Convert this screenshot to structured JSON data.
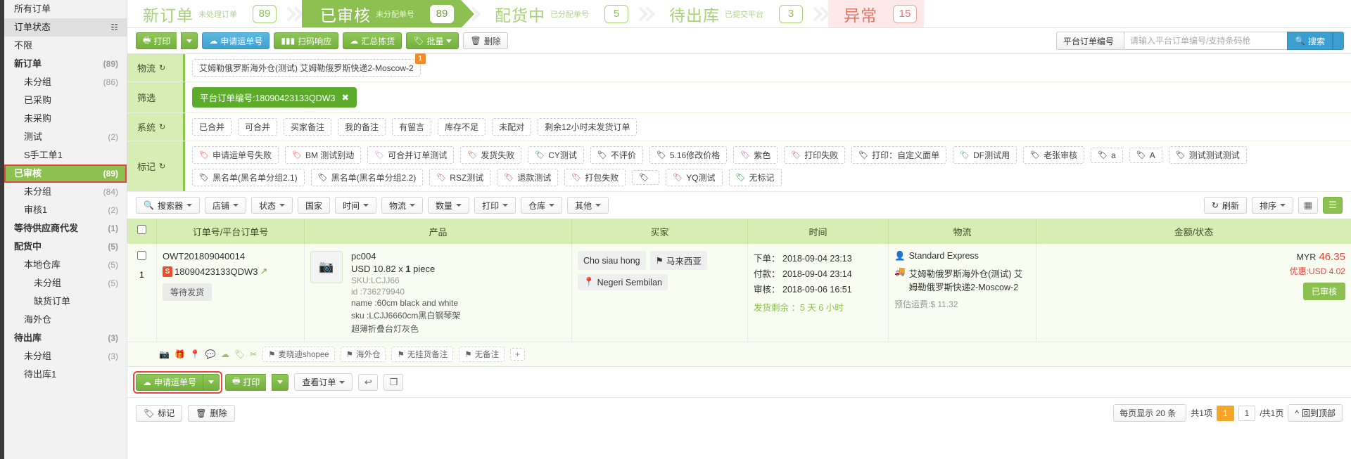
{
  "sidebar": {
    "items": [
      {
        "label": "所有订单",
        "count": "",
        "level": 0,
        "style": "plain"
      },
      {
        "label": "订单状态",
        "count": "",
        "level": 0,
        "style": "head",
        "icon": "sitemap-icon"
      },
      {
        "label": "不限",
        "count": "",
        "level": 0,
        "style": "plain"
      },
      {
        "label": "新订单",
        "count": "(89)",
        "level": 0,
        "style": "bold"
      },
      {
        "label": "未分组",
        "count": "(86)",
        "level": 1,
        "style": "plain"
      },
      {
        "label": "已采购",
        "count": "",
        "level": 1,
        "style": "plain"
      },
      {
        "label": "未采购",
        "count": "",
        "level": 1,
        "style": "plain"
      },
      {
        "label": "测试",
        "count": "(2)",
        "level": 1,
        "style": "plain"
      },
      {
        "label": "S手工单1",
        "count": "",
        "level": 1,
        "style": "plain"
      },
      {
        "label": "已审核",
        "count": "(89)",
        "level": 0,
        "style": "active"
      },
      {
        "label": "未分组",
        "count": "(84)",
        "level": 1,
        "style": "plain"
      },
      {
        "label": "审核1",
        "count": "(2)",
        "level": 1,
        "style": "plain"
      },
      {
        "label": "等待供应商代发",
        "count": "(1)",
        "level": 0,
        "style": "bold"
      },
      {
        "label": "配货中",
        "count": "(5)",
        "level": 0,
        "style": "bold"
      },
      {
        "label": "本地仓库",
        "count": "(5)",
        "level": 1,
        "style": "plain"
      },
      {
        "label": "未分组",
        "count": "(5)",
        "level": 2,
        "style": "plain"
      },
      {
        "label": "缺货订单",
        "count": "",
        "level": 2,
        "style": "plain"
      },
      {
        "label": "海外仓",
        "count": "",
        "level": 1,
        "style": "plain"
      },
      {
        "label": "待出库",
        "count": "(3)",
        "level": 0,
        "style": "bold"
      },
      {
        "label": "未分组",
        "count": "(3)",
        "level": 1,
        "style": "plain"
      },
      {
        "label": "待出库1",
        "count": "",
        "level": 1,
        "style": "plain"
      }
    ]
  },
  "steps": [
    {
      "name": "新订单",
      "sub": "未处理订单",
      "badge": "89",
      "state": "normal"
    },
    {
      "name": "已审核",
      "sub": "未分配单号",
      "badge": "89",
      "state": "current"
    },
    {
      "name": "配货中",
      "sub": "已分配单号",
      "badge": "5",
      "state": "normal"
    },
    {
      "name": "待出库",
      "sub": "已提交平台",
      "badge": "3",
      "state": "normal"
    },
    {
      "name": "异常",
      "sub": "",
      "badge": "15",
      "state": "error"
    }
  ],
  "toolbar": {
    "print": "打印",
    "apply_waybill": "申请运单号",
    "scan_response": "扫码响应",
    "batch_pick": "汇总拣货",
    "batch": "批量",
    "delete": "删除",
    "search_field_label": "平台订单编号",
    "search_placeholder": "请输入平台订单编号/支持条码枪",
    "search_button": "搜索"
  },
  "filters": {
    "rows": [
      {
        "label": "物流",
        "refresh": true,
        "type": "chips",
        "chips": [
          {
            "text": "艾姆勒俄罗斯海外仓(测试) 艾姆勒俄罗斯快递2-Moscow-2",
            "selected": false,
            "badge": "1"
          }
        ]
      },
      {
        "label": "筛选",
        "refresh": false,
        "type": "chips",
        "chips": [
          {
            "text": "平台订单编号:18090423133QDW3",
            "selected": true,
            "closable": true
          }
        ]
      },
      {
        "label": "系统",
        "refresh": true,
        "type": "chips",
        "chips": [
          {
            "text": "已合并"
          },
          {
            "text": "可合并"
          },
          {
            "text": "买家备注"
          },
          {
            "text": "我的备注"
          },
          {
            "text": "有留言"
          },
          {
            "text": "库存不足"
          },
          {
            "text": "未配对"
          },
          {
            "text": "剩余12小时未发货订单"
          }
        ]
      },
      {
        "label": "标记",
        "refresh": true,
        "type": "tags",
        "chips": [
          {
            "text": "申请运单号失败",
            "color": "#e8453c"
          },
          {
            "text": "BM 测试别动",
            "color": "#e8573c"
          },
          {
            "text": "可合并订单测试",
            "color": "#ea7fe0"
          },
          {
            "text": "发货失败",
            "color": "#e8453c"
          },
          {
            "text": "CY测试",
            "color": "#1a8a3a"
          },
          {
            "text": "不评价",
            "color": "#111111"
          },
          {
            "text": "5.16修改价格",
            "color": "#111111"
          },
          {
            "text": "紫色",
            "color": "#ec2fd0"
          },
          {
            "text": "打印失败",
            "color": "#e8453c"
          },
          {
            "text": "打印：自定义面单",
            "color": "#111111"
          },
          {
            "text": "DF测试用",
            "color": "#2a9d9d"
          },
          {
            "text": "老张审核",
            "color": "#111111"
          },
          {
            "text": "a",
            "color": "#111111"
          },
          {
            "text": "A",
            "color": "#111111"
          },
          {
            "text": "测试测试测试",
            "color": "#111111"
          },
          {
            "text": "黑名单(黑名单分组2.1)",
            "color": "#111111"
          },
          {
            "text": "黑名单(黑名单分组2.2)",
            "color": "#111111"
          },
          {
            "text": "RSZ测试",
            "color": "#e8453c"
          },
          {
            "text": "退款测试",
            "color": "#e8453c"
          },
          {
            "text": "打包失败",
            "color": "#e8453c"
          },
          {
            "text": "",
            "color": "#111111"
          },
          {
            "text": "YQ测试",
            "color": "#e8453c"
          },
          {
            "text": "无标记",
            "color": "#1a8a3a"
          }
        ]
      }
    ]
  },
  "subbar": {
    "buttons": [
      {
        "label": "搜索器",
        "icon": "search-icon",
        "caret": true
      },
      {
        "label": "店铺",
        "caret": true
      },
      {
        "label": "状态",
        "caret": true
      },
      {
        "label": "国家",
        "caret": false
      },
      {
        "label": "时间",
        "caret": true
      },
      {
        "label": "物流",
        "caret": true
      },
      {
        "label": "数量",
        "caret": true
      },
      {
        "label": "打印",
        "caret": true
      },
      {
        "label": "仓库",
        "caret": true
      },
      {
        "label": "其他",
        "caret": true
      }
    ],
    "refresh": "刷新",
    "sort": "排序",
    "view_grid": "grid-view-icon",
    "view_list": "list-view-icon"
  },
  "table": {
    "headers": [
      "",
      "订单号/平台订单号",
      "产品",
      "买家",
      "时间",
      "物流",
      "金额/状态"
    ],
    "rows": [
      {
        "index": "1",
        "order_no": "OWT201809040014",
        "platform_no": "18090423133QDW3",
        "platform_icon": "shopee-icon",
        "status_pill": "等待发货",
        "product": {
          "name": "pc004",
          "price": "USD 10.82 x ",
          "qty": "1",
          "unit": " piece",
          "sku": "SKU:LCJJ66",
          "id": "id :736279940",
          "name_line": "name :60cm black and white",
          "sku_line": "sku :LCJJ6660cm黑白钢琴架",
          "title_cn": "超薄折叠台灯灰色"
        },
        "buyer": {
          "name": "Cho siau hong",
          "country": "马来西亚",
          "region": "Negeri Sembilan"
        },
        "time": {
          "order_label": "下单：",
          "order_value": "2018-09-04 23:13",
          "pay_label": "付款：",
          "pay_value": "2018-09-04 23:14",
          "audit_label": "审核：",
          "audit_value": "2018-09-06 16:51",
          "remain": "发货剩余 ：5 天 6 小时"
        },
        "logistics": {
          "carrier": "Standard Express",
          "channel": "艾姆勒俄罗斯海外仓(测试) 艾姆勒俄罗斯快递2-Moscow-2",
          "fee": "预估运费:$ 11.32"
        },
        "amount": {
          "currency": "MYR",
          "value": "46.35",
          "discount": "优惠:USD 4.02",
          "status": "已审核"
        },
        "row_tags": [
          {
            "label": "麦晓迪shopee",
            "icon": "link-icon"
          },
          {
            "label": "海外仓",
            "icon": "plane-icon"
          },
          {
            "label": "无挂货备注",
            "icon": "note-icon"
          },
          {
            "label": "无备注",
            "icon": "note-icon"
          }
        ]
      }
    ]
  },
  "row_actions": {
    "apply_waybill": "申请运单号",
    "print": "打印",
    "view_order": "查看订单",
    "undo_icon": "undo-icon",
    "copy_icon": "copy-icon"
  },
  "bottom": {
    "mark": "标记",
    "delete": "删除",
    "per_page": "每页显示 20 条",
    "total": "共1项",
    "page_cur": "1",
    "page_input": "1",
    "page_total": "/共1页",
    "back_top": "回到顶部"
  }
}
